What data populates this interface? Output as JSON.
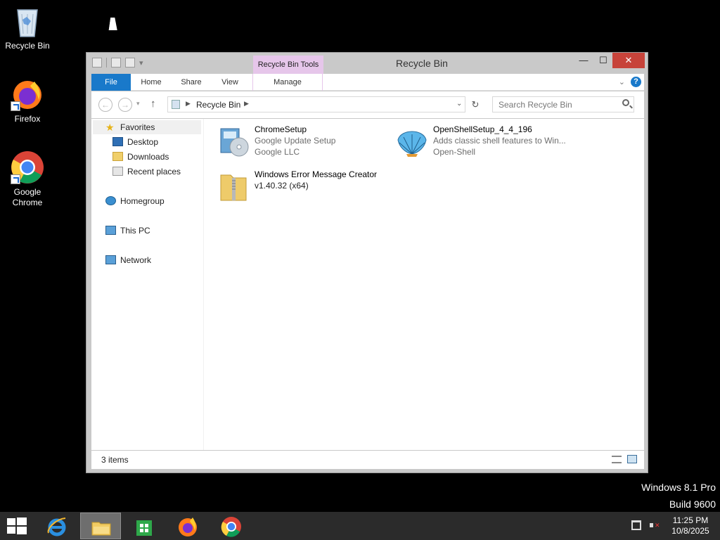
{
  "desktop": {
    "icons": [
      {
        "label": "Recycle Bin"
      },
      {
        "label": "Firefox"
      },
      {
        "label": "Google Chrome"
      }
    ]
  },
  "window": {
    "title": "Recycle Bin",
    "contextual_tab_header": "Recycle Bin Tools",
    "ribbon_tabs": {
      "file": "File",
      "home": "Home",
      "share": "Share",
      "view": "View",
      "manage": "Manage"
    },
    "address": {
      "path": "Recycle Bin",
      "search_placeholder": "Search Recycle Bin"
    },
    "nav_pane": {
      "favorites": "Favorites",
      "desktop": "Desktop",
      "downloads": "Downloads",
      "recent_places": "Recent places",
      "homegroup": "Homegroup",
      "this_pc": "This PC",
      "network": "Network"
    },
    "files": [
      {
        "name": "ChromeSetup",
        "line2": "Google Update Setup",
        "line3": "Google LLC"
      },
      {
        "name": "OpenShellSetup_4_4_196",
        "line2": "Adds classic shell features to Win...",
        "line3": "Open-Shell"
      },
      {
        "name": "Windows Error Message Creator",
        "line2": "v1.40.32 (x64)",
        "line3": ""
      }
    ],
    "status": "3 items"
  },
  "watermark": {
    "line1": "Windows 8.1 Pro",
    "line2": "Build 9600"
  },
  "taskbar": {
    "time": "11:25 PM",
    "date": "10/8/2025"
  },
  "colors": {
    "file_tab": "#1979ca",
    "contextual_tab": "#e6c6ea",
    "close_button": "#c7433a",
    "taskbar": "#2b2b2b"
  }
}
